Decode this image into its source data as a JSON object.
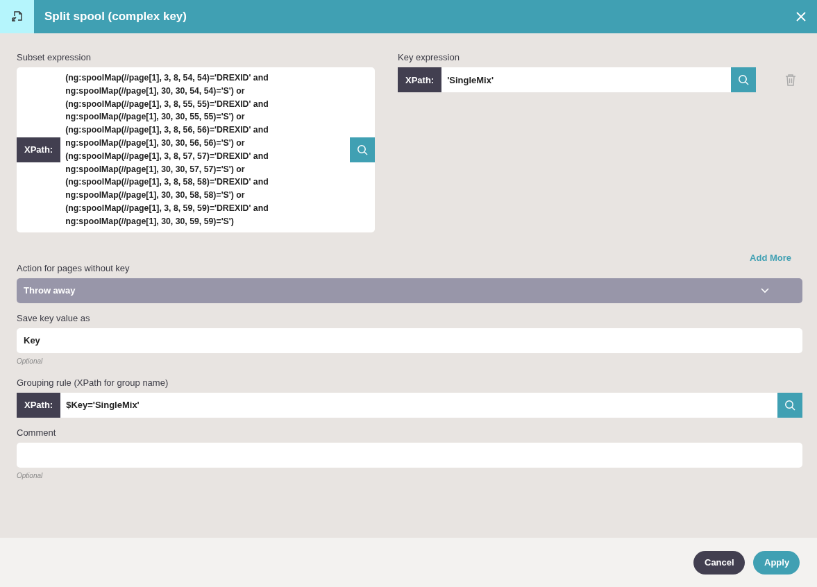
{
  "window": {
    "title": "Split spool (complex key)"
  },
  "subset_expression": {
    "label": "Subset expression",
    "prefix": "XPath:",
    "value": "(ng:spoolMap(//page[1], 3, 8, 54, 54)='DREXID' and ng:spoolMap(//page[1], 30, 30, 54, 54)='S') or (ng:spoolMap(//page[1], 3, 8, 55, 55)='DREXID' and ng:spoolMap(//page[1], 30, 30, 55, 55)='S') or (ng:spoolMap(//page[1], 3, 8, 56, 56)='DREXID' and ng:spoolMap(//page[1], 30, 30, 56, 56)='S') or (ng:spoolMap(//page[1], 3, 8, 57, 57)='DREXID' and ng:spoolMap(//page[1], 30, 30, 57, 57)='S') or (ng:spoolMap(//page[1], 3, 8, 58, 58)='DREXID' and ng:spoolMap(//page[1], 30, 30, 58, 58)='S') or (ng:spoolMap(//page[1], 3, 8, 59, 59)='DREXID' and ng:spoolMap(//page[1], 30, 30, 59, 59)='S')"
  },
  "key_expression": {
    "label": "Key expression",
    "prefix": "XPath:",
    "value": "'SingleMix'"
  },
  "add_more": "Add More",
  "action": {
    "label": "Action for pages without key",
    "value": "Throw away"
  },
  "save_key": {
    "label": "Save key value as",
    "value": "Key",
    "hint": "Optional"
  },
  "grouping_rule": {
    "label": "Grouping rule (XPath for group name)",
    "prefix": "XPath:",
    "value": "$Key='SingleMix'"
  },
  "comment": {
    "label": "Comment",
    "hint": "Optional"
  },
  "buttons": {
    "cancel": "Cancel",
    "apply": "Apply"
  }
}
